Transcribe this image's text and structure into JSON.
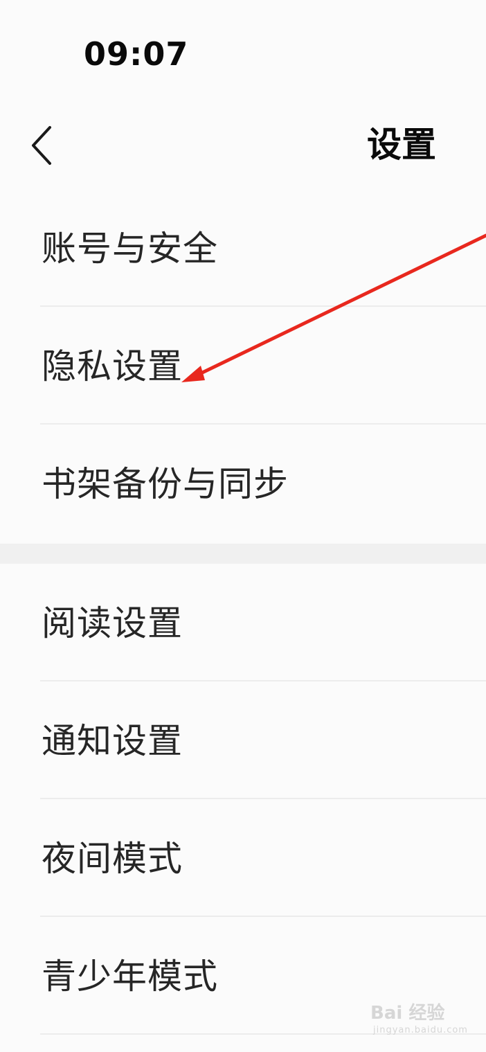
{
  "status_bar": {
    "time": "09:07"
  },
  "nav": {
    "back_icon": "chevron-left-icon",
    "title": "设置"
  },
  "menu_groups": [
    {
      "items": [
        {
          "label": "账号与安全"
        },
        {
          "label": "隐私设置"
        },
        {
          "label": "书架备份与同步"
        }
      ]
    },
    {
      "items": [
        {
          "label": "阅读设置"
        },
        {
          "label": "通知设置"
        },
        {
          "label": "夜间模式"
        },
        {
          "label": "青少年模式"
        }
      ]
    }
  ],
  "annotation": {
    "type": "arrow",
    "color": "#e8281e",
    "points_to": "隐私设置"
  },
  "watermark": {
    "brand": "Bai 经验",
    "domain": "jingyan.baidu.com"
  },
  "colors": {
    "background": "#fbfbfb",
    "separator": "#f0f0f0",
    "divider": "#ececec",
    "text": "#262626"
  }
}
